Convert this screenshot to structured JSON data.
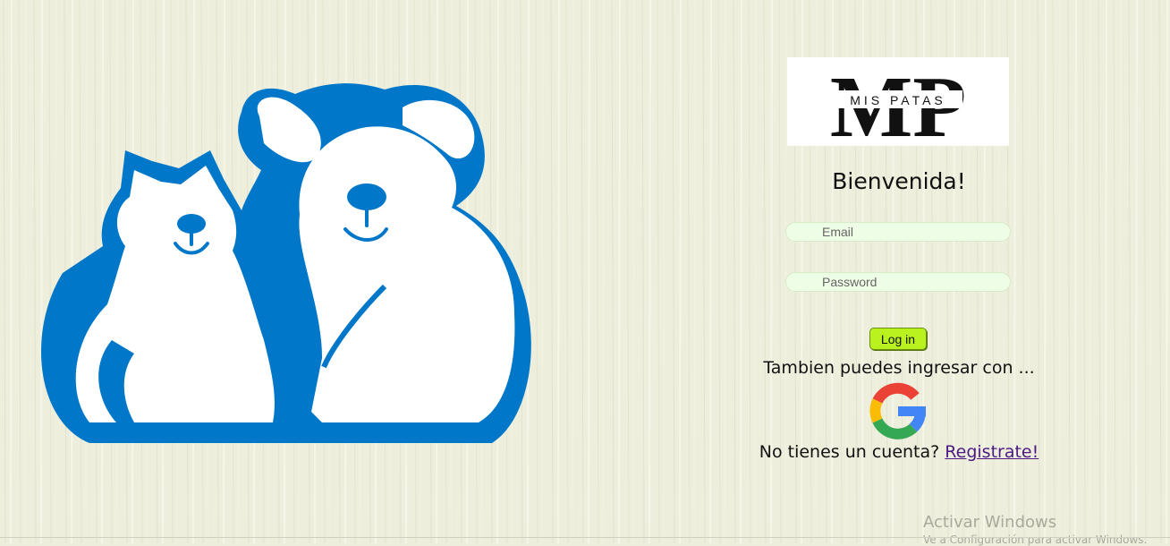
{
  "brand": {
    "monogram": "MP",
    "name": "MIS PATAS"
  },
  "login": {
    "welcome": "Bienvenida!",
    "email_placeholder": "Email",
    "password_placeholder": "Password",
    "login_button": "Log in",
    "alt_text": "Tambien puedes ingresar con ...",
    "google_icon": "google-icon",
    "signup_text": "No tienes un cuenta?",
    "signup_link": "Registrate!"
  },
  "os_overlay": {
    "title": "Activar Windows",
    "subtitle": "Ve a Configuración para activar Windows."
  },
  "colors": {
    "background": "#eeeedd",
    "mascot_blue": "#0077c8",
    "login_button": "#b9f21f",
    "link": "#4b1a82"
  }
}
